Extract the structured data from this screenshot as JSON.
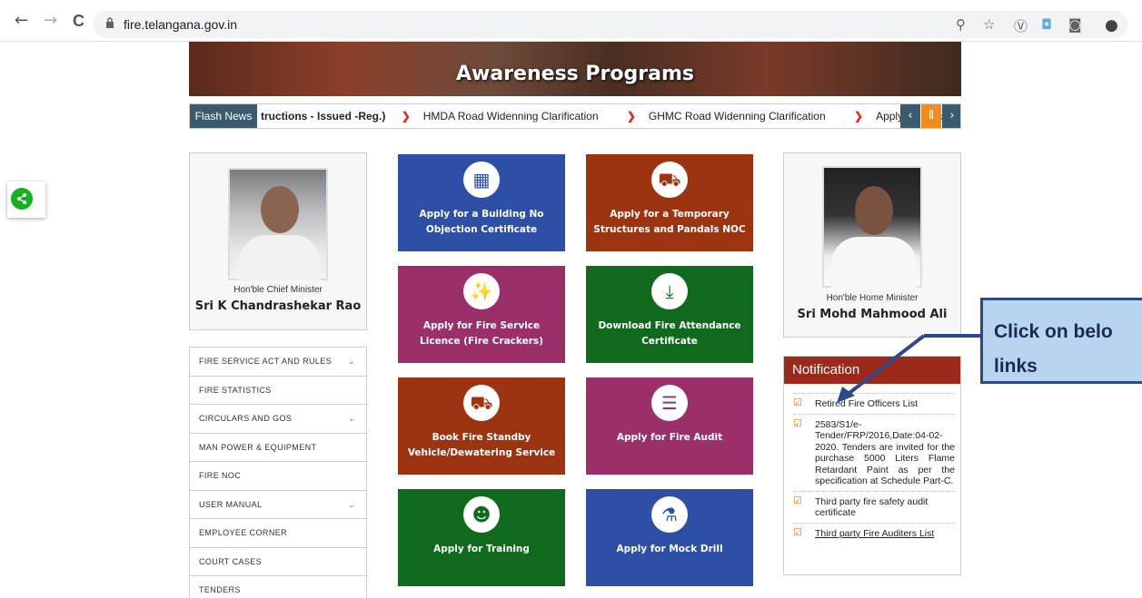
{
  "browser": {
    "url": "fire.telangana.gov.in",
    "back": "←",
    "forward": "→",
    "reload": "C"
  },
  "banner": {
    "title": "Awareness Programs"
  },
  "flash": {
    "label": "Flash News",
    "items": [
      "tructions - Issued -Reg.)",
      "HMDA Road Widenning Clarification",
      "GHMC Road Widenning Clarification",
      "Apply for Mock Drill"
    ]
  },
  "cm": {
    "title": "Hon'ble Chief Minister",
    "name": "Sri K Chandrashekar Rao"
  },
  "hm": {
    "title": "Hon'ble Home Minister",
    "name": "Sri Mohd Mahmood Ali"
  },
  "menu": [
    {
      "label": "FIRE SERVICE ACT AND RULES",
      "arrow": "⌄"
    },
    {
      "label": "FIRE STATISTICS",
      "arrow": ""
    },
    {
      "label": "CIRCULARS AND GOS",
      "arrow": "⌄"
    },
    {
      "label": "MAN POWER & EQUIPMENT",
      "arrow": ""
    },
    {
      "label": "FIRE NOC",
      "arrow": ""
    },
    {
      "label": "USER MANUAL",
      "arrow": "⌄"
    },
    {
      "label": "EMPLOYEE CORNER",
      "arrow": ""
    },
    {
      "label": "COURT CASES",
      "arrow": ""
    },
    {
      "label": "TENDERS",
      "arrow": ""
    }
  ],
  "tiles": [
    {
      "title": "Apply for a Building No Objection Certificate",
      "color": "#2e4fa6",
      "icon": "building-icon"
    },
    {
      "title": "Apply for a Temporary Structures and Pandals NOC",
      "color": "#9c3412",
      "icon": "truck-icon"
    },
    {
      "title": "Apply for Fire Service Licence (Fire Crackers)",
      "color": "#9b2f6a",
      "icon": "firecracker-icon"
    },
    {
      "title": "Download Fire Attendance Certificate",
      "color": "#0f6a1e",
      "icon": "download-icon"
    },
    {
      "title": "Book Fire Standby Vehicle/Dewatering Service",
      "color": "#9c3412",
      "icon": "truck-icon"
    },
    {
      "title": "Apply for Fire Audit",
      "color": "#9b2f6a",
      "icon": "list-icon"
    },
    {
      "title": "Apply for Training",
      "color": "#0f6a1e",
      "icon": "group-icon"
    },
    {
      "title": "Apply for Mock Drill",
      "color": "#2e4fa6",
      "icon": "extinguisher-icon"
    }
  ],
  "notification": {
    "title": "Notification",
    "items": [
      "Retired Fire Officers List",
      "2583/S1/e-Tender/FRP/2016,Date:04-02-2020. Tenders are invited for the purchase 5000 Liters Flame Retardant Paint as per the specification at Schedule Part-C.",
      "Third party fire safety audit certificate",
      "Third party Fire Auditers List"
    ]
  },
  "callout": {
    "text": "Click on belo\nlinks"
  }
}
